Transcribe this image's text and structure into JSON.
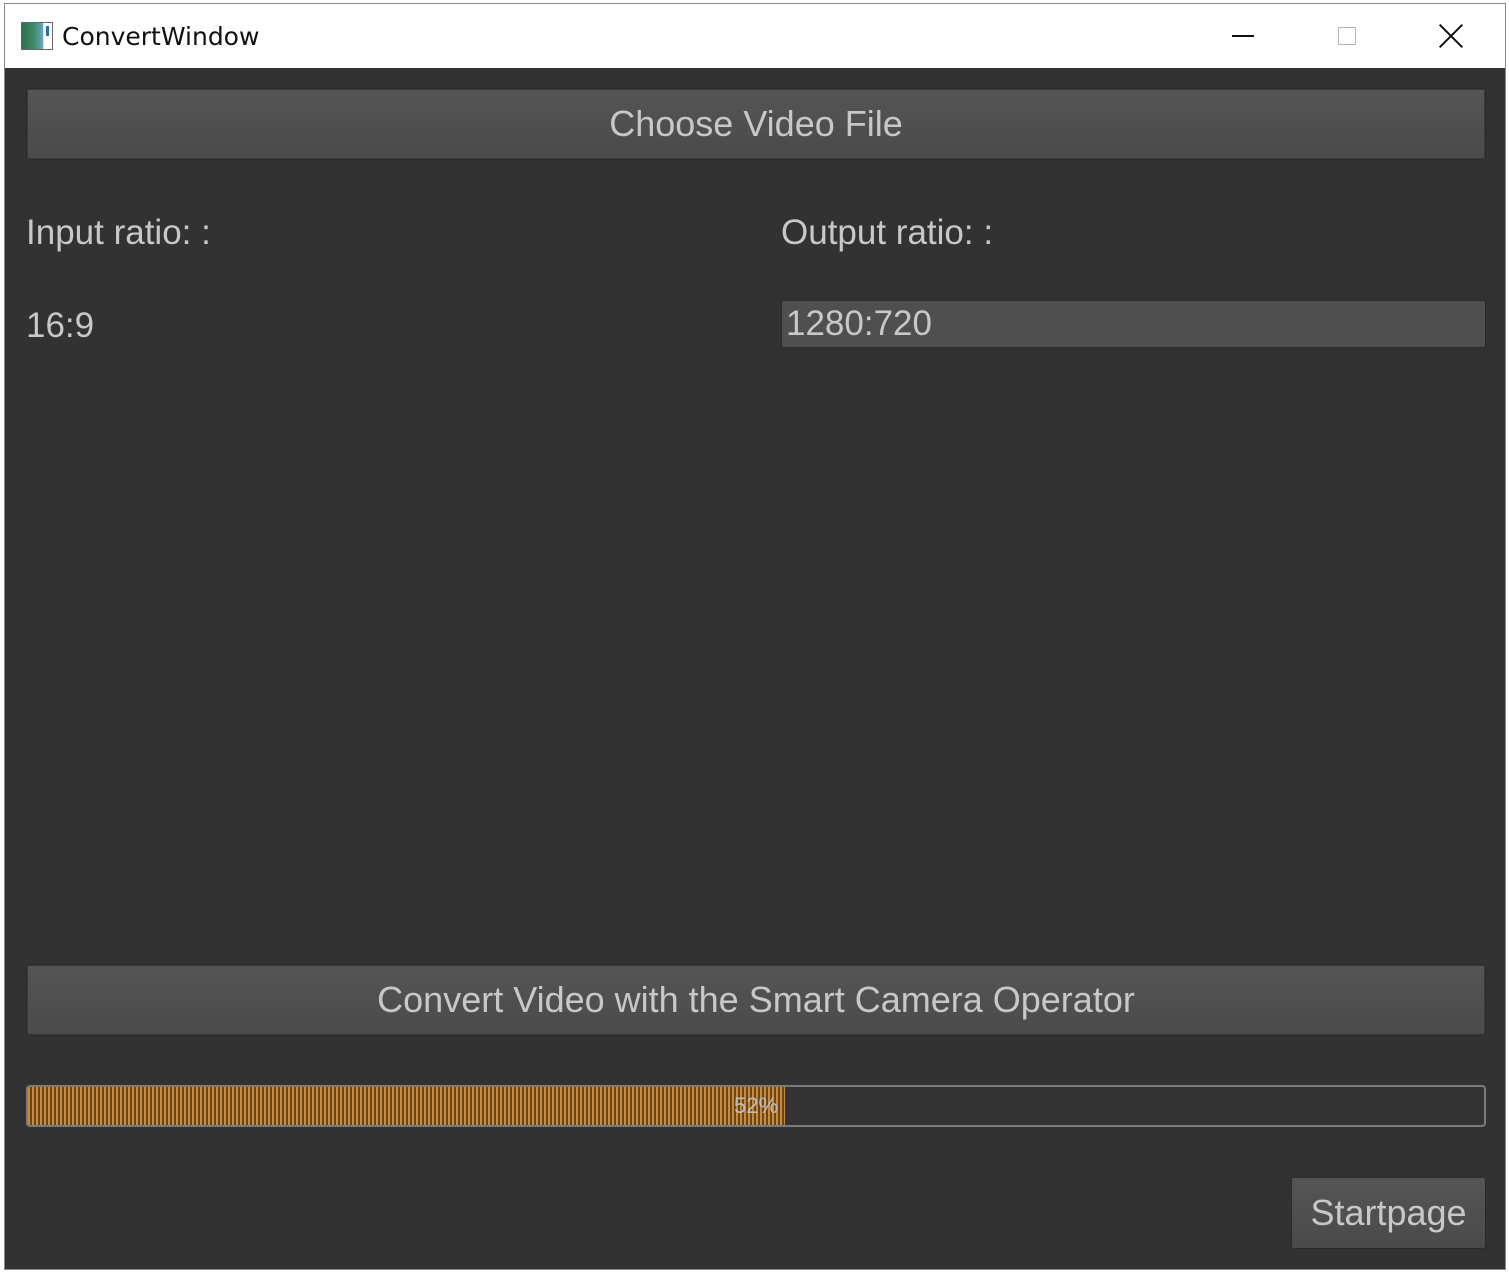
{
  "window": {
    "title": "ConvertWindow"
  },
  "buttons": {
    "choose_video": "Choose Video File",
    "convert_video": "Convert Video with the Smart Camera Operator",
    "startpage": "Startpage"
  },
  "ratios": {
    "input_label": "Input ratio: :",
    "input_value": "16:9",
    "output_label": "Output ratio: :",
    "output_value": "1280:720"
  },
  "progress": {
    "value": 52,
    "text": "52%",
    "fill_color": "#c98a3a"
  },
  "colors": {
    "background": "#323232",
    "button": "#4f4f4f",
    "text": "#c8c8c8"
  },
  "icons": {
    "app": "app-icon",
    "minimize": "minimize-icon",
    "maximize": "maximize-icon",
    "close": "close-icon"
  }
}
